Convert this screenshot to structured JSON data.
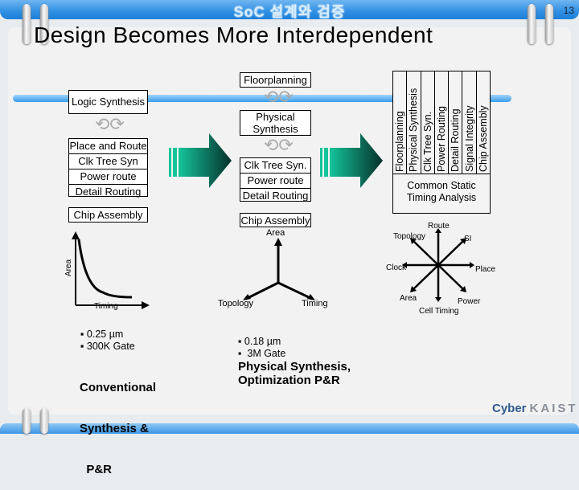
{
  "header": {
    "title": "SoC 설계와 검증",
    "page_number": "13"
  },
  "slide": {
    "title": "Design Becomes More Interdependent"
  },
  "conventional": {
    "logic_synthesis": "Logic Synthesis",
    "stack": [
      "Place and Route",
      "Clk Tree Syn",
      "Power route",
      "Detail Routing"
    ],
    "chip_assembly": "Chip Assembly",
    "graph": {
      "ylabel": "Area",
      "xlabel": "Timing"
    },
    "bullets": [
      "▪ 0.25 µm",
      "▪ 300K Gate"
    ],
    "caption": [
      "Conventional",
      "Synthesis &",
      "  P&R"
    ]
  },
  "physical": {
    "floorplanning": "Floorplanning",
    "physical_synthesis": [
      "Physical",
      "Synthesis"
    ],
    "stack": [
      "Clk Tree Syn.",
      "Power route",
      "Detail Routing"
    ],
    "chip_assembly": "Chip Assembly",
    "axes": {
      "top": "Area",
      "left": "Topology",
      "right": "Timing"
    },
    "bullets": [
      "▪ 0.18 µm",
      "▪  3M Gate"
    ],
    "caption": [
      "Physical Synthesis,",
      "Optimization P&R"
    ]
  },
  "unified": {
    "columns": [
      "Floorplanning",
      "Physical Synthesis",
      "Clk Tree Syn.",
      "Power Routing",
      "Detail Routing",
      "Signal Integrity",
      "Chip Assembly"
    ],
    "footer": [
      "Common Static",
      "Timing Analysis"
    ],
    "star": {
      "route": "Route",
      "topology": "Topology",
      "si": "SI",
      "clock": "Clock",
      "place": "Place",
      "area": "Area",
      "power": "Power",
      "cell_timing": "Cell Timing"
    }
  },
  "logo": {
    "cyber": "Cyber",
    "kaist": "KAIST"
  }
}
